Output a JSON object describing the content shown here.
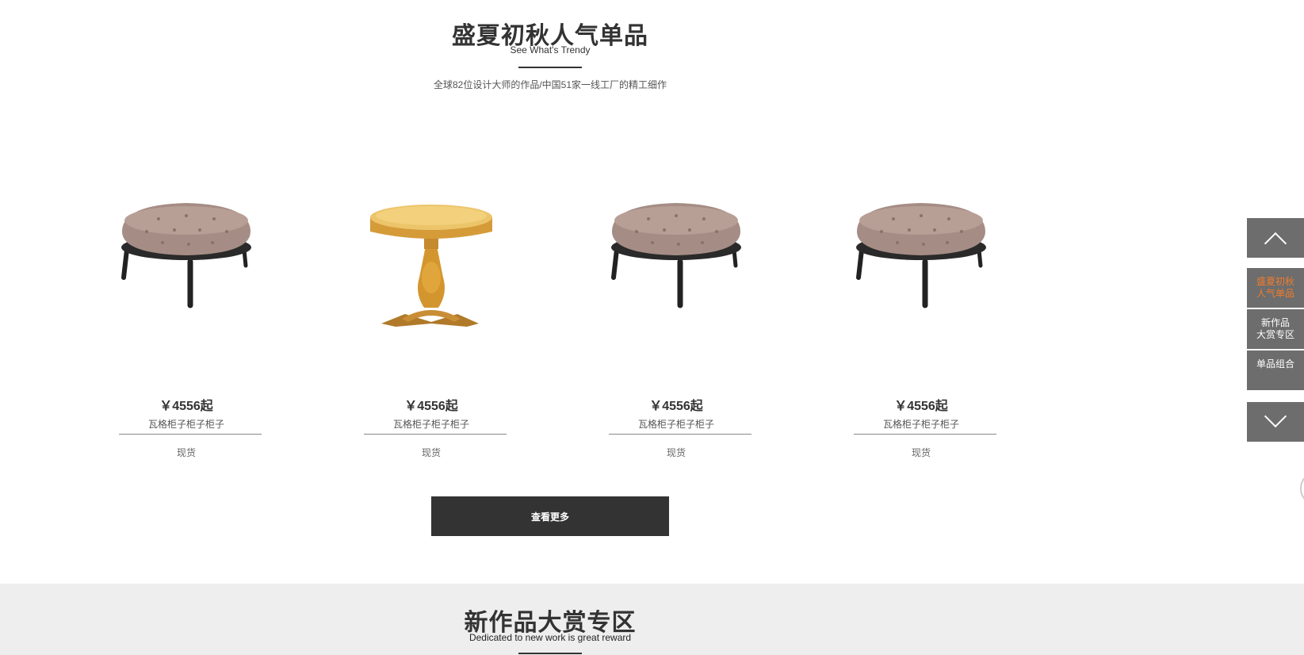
{
  "section1": {
    "title": "盛夏初秋人气单品",
    "subtitle": "See What's Trendy",
    "description": "全球82位设计大师的作品/中国51家一线工厂的精工细作"
  },
  "products": [
    {
      "image": "round-ottoman",
      "price": "￥4556起",
      "name": "瓦格柜子柜子柜子",
      "stock": "现货"
    },
    {
      "image": "round-pedestal-table",
      "price": "￥4556起",
      "name": "瓦格柜子柜子柜子",
      "stock": "现货"
    },
    {
      "image": "round-ottoman",
      "price": "￥4556起",
      "name": "瓦格柜子柜子柜子",
      "stock": "现货"
    },
    {
      "image": "round-ottoman",
      "price": "￥4556起",
      "name": "瓦格柜子柜子柜子",
      "stock": "现货"
    }
  ],
  "more_button": "查看更多",
  "section2": {
    "title": "新作品大赏专区",
    "subtitle": "Dedicated to new work is great reward"
  },
  "side_nav": {
    "up_icon": "chevron-up-icon",
    "items": [
      {
        "line1": "盛夏初秋",
        "line2": "人气单品",
        "active": true
      },
      {
        "line1": "新作品",
        "line2": "大赏专区",
        "active": false
      },
      {
        "line1": "单品组合",
        "line2": "",
        "active": false
      }
    ],
    "down_icon": "chevron-down-icon"
  },
  "colors": {
    "text": "#333333",
    "accent": "#f07c2a",
    "nav_bg": "#6d6d6d",
    "button_bg": "#333333",
    "section_bg": "#eeeeee"
  }
}
